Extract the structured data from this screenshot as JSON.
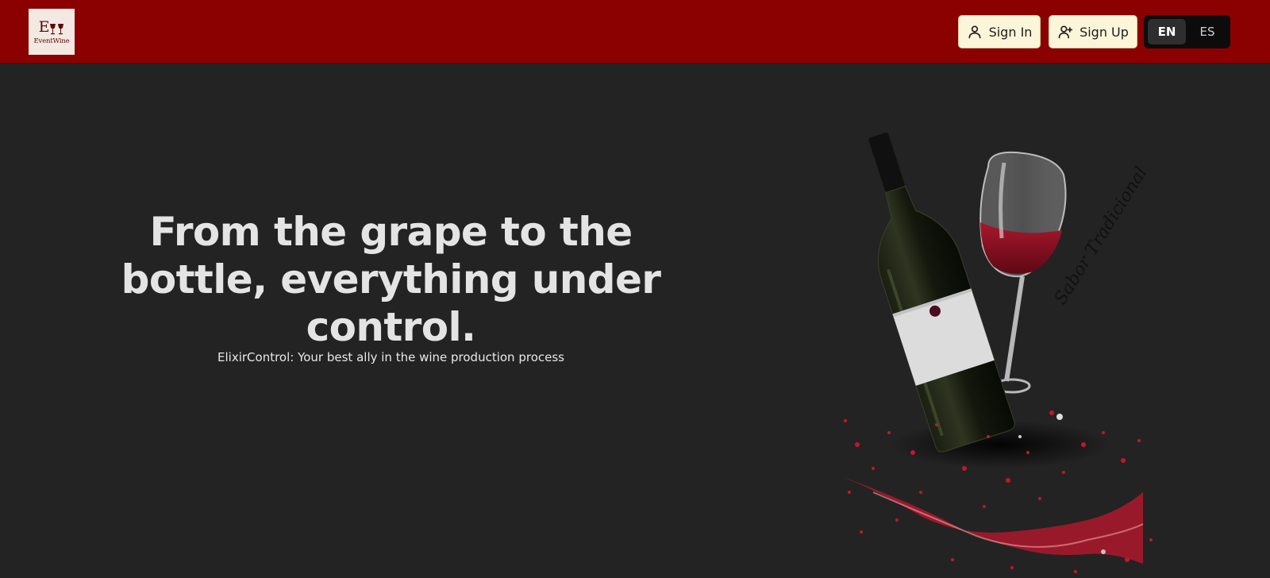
{
  "header": {
    "logo": {
      "monogram": "EW",
      "name": "EventWine"
    },
    "sign_in_label": "Sign In",
    "sign_up_label": "Sign Up",
    "languages": [
      "EN",
      "ES"
    ],
    "selected_language": "EN"
  },
  "hero": {
    "title": "From the grape to the bottle, everything under control.",
    "subtitle": "ElixirControl: Your best ally in the wine production process",
    "image_script_text": "Sabor Tradicional"
  },
  "colors": {
    "header_bg": "#8b0000",
    "page_bg": "#232323",
    "button_bg": "#fbf6d9",
    "lang_toggle_bg": "#0c0c0c"
  }
}
